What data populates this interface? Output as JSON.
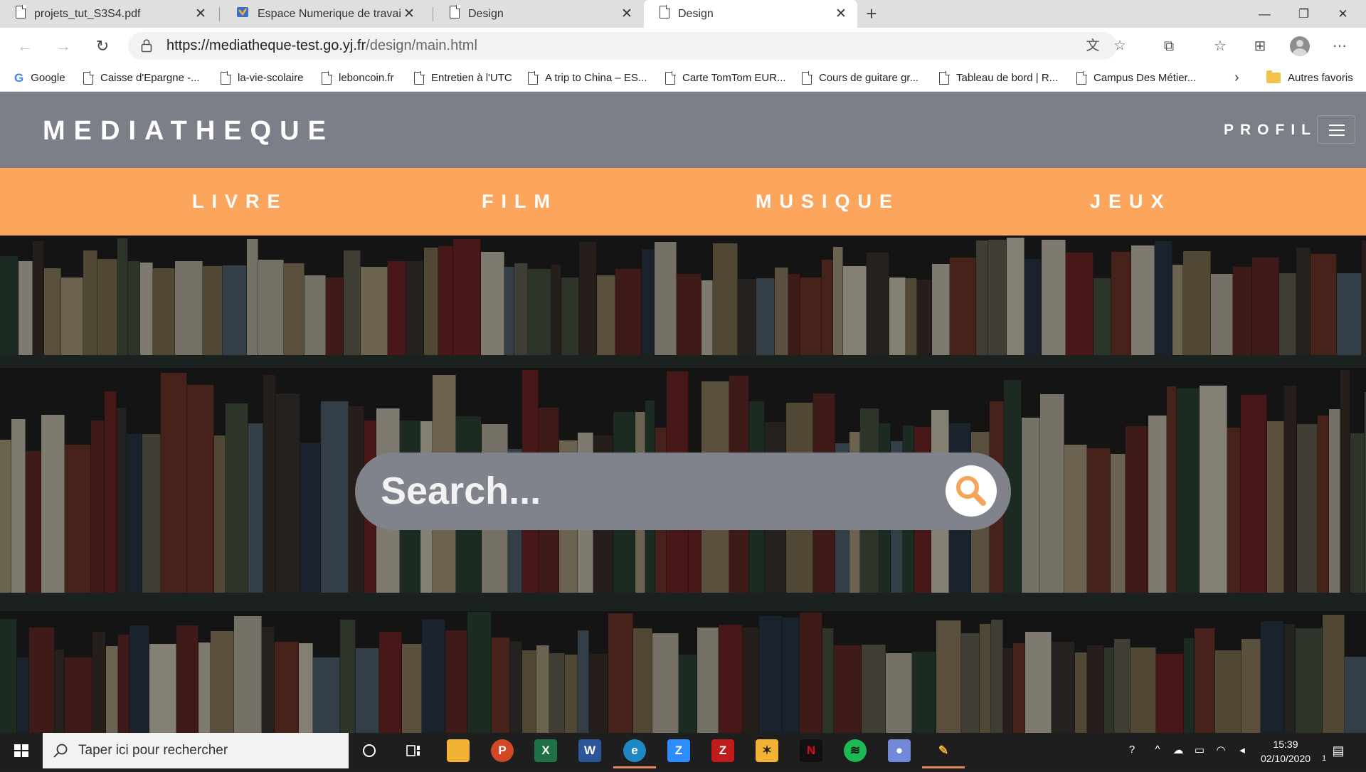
{
  "browser": {
    "tabs": [
      {
        "title": "projets_tut_S3S4.pdf",
        "icon": "document-icon"
      },
      {
        "title": "Espace Numerique de travail UFC",
        "icon": "ent-favicon-icon"
      },
      {
        "title": "Design",
        "icon": "document-icon"
      },
      {
        "title": "Design",
        "icon": "document-icon",
        "active": true
      }
    ],
    "new_tab_label": "+",
    "window_controls": {
      "minimize": "—",
      "maximize": "❐",
      "close": "✕"
    },
    "address": {
      "url_host": "https://mediatheque-test.go.yj.fr",
      "url_path": "/design/main.html"
    },
    "favorites": [
      {
        "label": "Google",
        "icon": "google-icon"
      },
      {
        "label": "Caisse d'Epargne -...",
        "icon": "document-icon"
      },
      {
        "label": "la-vie-scolaire",
        "icon": "document-icon"
      },
      {
        "label": "leboncoin.fr",
        "icon": "document-icon"
      },
      {
        "label": "Entretien à l'UTC",
        "icon": "document-icon"
      },
      {
        "label": "A trip to China – ES...",
        "icon": "document-icon"
      },
      {
        "label": "Carte TomTom EUR...",
        "icon": "document-icon"
      },
      {
        "label": "Cours de guitare gr...",
        "icon": "document-icon"
      },
      {
        "label": "Tableau de bord | R...",
        "icon": "document-icon"
      },
      {
        "label": "Campus Des Métier...",
        "icon": "document-icon"
      }
    ],
    "other_favorites": "Autres favoris"
  },
  "site": {
    "brand": "MEDIATHEQUE",
    "profile_link": "PROFIL",
    "categories": [
      "LIVRE",
      "FILM",
      "MUSIQUE",
      "JEUX"
    ],
    "search_placeholder": "Search...",
    "colors": {
      "header": "#7c7f87",
      "category_bar": "#fba65c",
      "accent": "#f4a55a"
    }
  },
  "taskbar": {
    "search_placeholder": "Taper ici pour rechercher",
    "apps": [
      "cortana",
      "task-view",
      "file-explorer",
      "powerpoint",
      "excel",
      "word",
      "edge",
      "zoom",
      "filezilla",
      "app-yellow",
      "netflix",
      "spotify",
      "discord",
      "app-tools"
    ],
    "clock_time": "15:39",
    "clock_date": "02/10/2020",
    "notification_count": "1"
  }
}
